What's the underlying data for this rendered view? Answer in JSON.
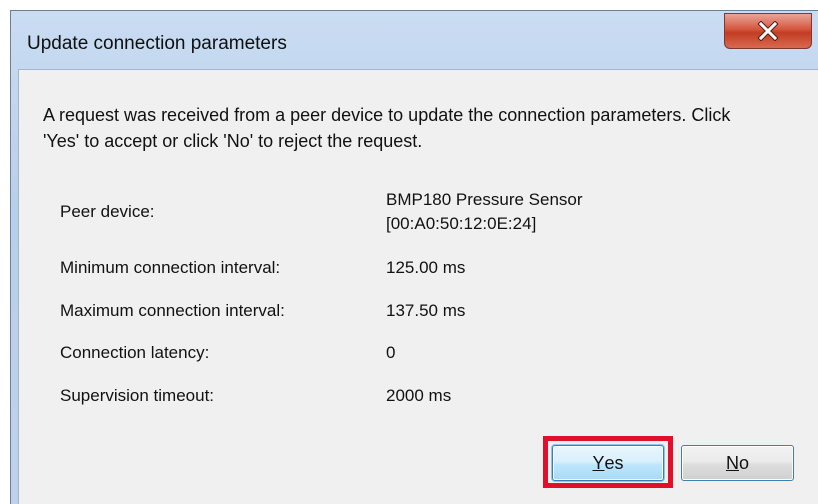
{
  "window": {
    "title": "Update connection parameters",
    "close_icon": "close-icon"
  },
  "message": "A request was received from a peer device to update the connection parameters. Click 'Yes' to accept or click 'No' to reject the request.",
  "fields": [
    {
      "label": "Peer device:",
      "value_line1": "BMP180 Pressure Sensor",
      "value_line2": "[00:A0:50:12:0E:24]"
    },
    {
      "label": "Minimum connection interval:",
      "value": "125.00 ms"
    },
    {
      "label": "Maximum connection interval:",
      "value": "137.50 ms"
    },
    {
      "label": "Connection latency:",
      "value": "0"
    },
    {
      "label": "Supervision timeout:",
      "value": "2000 ms"
    }
  ],
  "buttons": {
    "yes_mnemonic": "Y",
    "yes_rest": "es",
    "no_mnemonic": "N",
    "no_rest": "o"
  },
  "colors": {
    "highlight": "#e0102a",
    "close_button": "#c23d24"
  }
}
